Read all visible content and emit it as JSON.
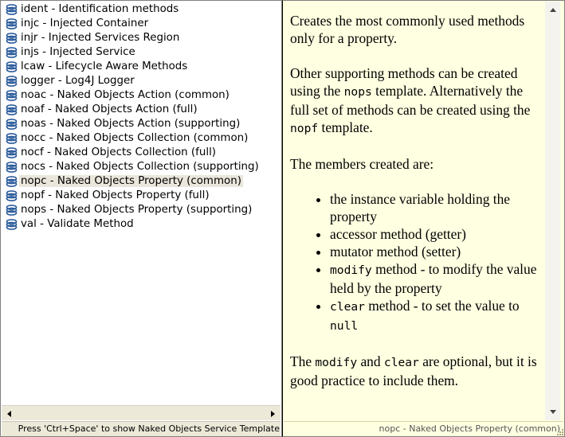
{
  "proposals": [
    {
      "label": "ident - Identification methods"
    },
    {
      "label": "injc - Injected Container"
    },
    {
      "label": "injr - Injected Services Region"
    },
    {
      "label": "injs - Injected Service"
    },
    {
      "label": "lcaw - Lifecycle Aware Methods"
    },
    {
      "label": "logger - Log4J Logger"
    },
    {
      "label": "noac - Naked Objects Action (common)"
    },
    {
      "label": "noaf - Naked Objects Action (full)"
    },
    {
      "label": "noas - Naked Objects Action (supporting)"
    },
    {
      "label": "nocc - Naked Objects Collection (common)"
    },
    {
      "label": "nocf - Naked Objects Collection (full)"
    },
    {
      "label": "nocs - Naked Objects Collection (supporting)"
    },
    {
      "label": "nopc - Naked Objects Property (common)",
      "selected": true
    },
    {
      "label": "nopf - Naked Objects Property (full)"
    },
    {
      "label": "nops - Naked Objects Property (supporting)"
    },
    {
      "label": "val - Validate Method"
    }
  ],
  "hint": "Press 'Ctrl+Space' to show Naked Objects Service Template",
  "description": {
    "p1": "Creates the most commonly used methods only for a property.",
    "p2_a": "Other supporting methods can be created using the ",
    "p2_code1": "nops",
    "p2_b": " template. Alternatively the full set of methods can be created using the ",
    "p2_code2": "nopf",
    "p2_c": " template.",
    "p3": "The members created are:",
    "items": {
      "i1": "the instance variable holding the property",
      "i2": "accessor method (getter)",
      "i3": "mutator method (setter)",
      "i4_code": "modify",
      "i4_text": " method - to modify the value held by the property",
      "i5_code": "clear",
      "i5_text": " method - to set the value to ",
      "i5_code2": "null"
    },
    "p4_code1": "modify",
    "p4_a": " and ",
    "p4_code2": "clear",
    "p4_b": " are optional, but it is good practice to include them.",
    "p4_prefix": "The "
  },
  "status": "nopc - Naked Objects Property (common)",
  "icons": {
    "template": "template-icon",
    "scroll_left": "arrow-left-icon",
    "scroll_right": "arrow-right-icon",
    "scroll_up": "arrow-up-icon",
    "scroll_down": "arrow-down-icon",
    "resize": "resize-grip-icon"
  },
  "colors": {
    "selection": "#ebe6dc",
    "popup_background": "#ffffe1",
    "template_icon": "#2a5a9a"
  }
}
